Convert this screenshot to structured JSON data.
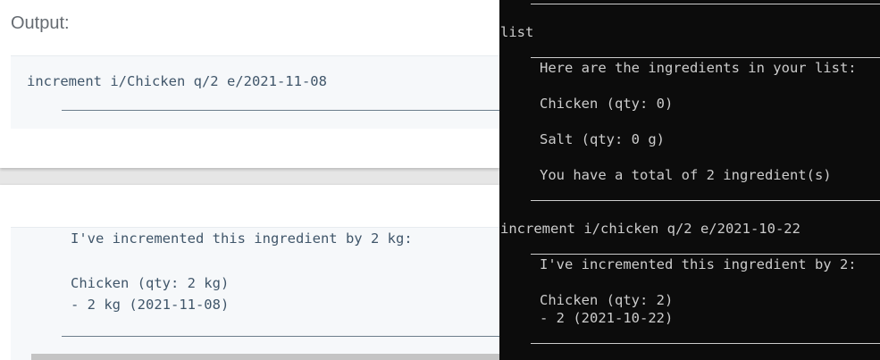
{
  "doc": {
    "output_label": "Output:",
    "top_command": "increment i/Chicken q/2 e/2021-11-08",
    "bottom_lines": [
      "I've incremented this ingredient by 2 kg:",
      "Chicken (qty: 2 kg)",
      "- 2 kg (2021-11-08)"
    ]
  },
  "terminal": {
    "cmd_list": "list",
    "list_header": "Here are the ingredients in your list:",
    "list_items": [
      "Chicken (qty: 0)",
      "Salt (qty: 0 g)"
    ],
    "list_total": "You have a total of 2 ingredient(s)",
    "cmd_increment": "increment i/chicken q/2 e/2021-10-22",
    "inc_message": "I've incremented this ingredient by 2:",
    "inc_item": "Chicken (qty: 2)",
    "inc_batch": "- 2 (2021-10-22)"
  }
}
